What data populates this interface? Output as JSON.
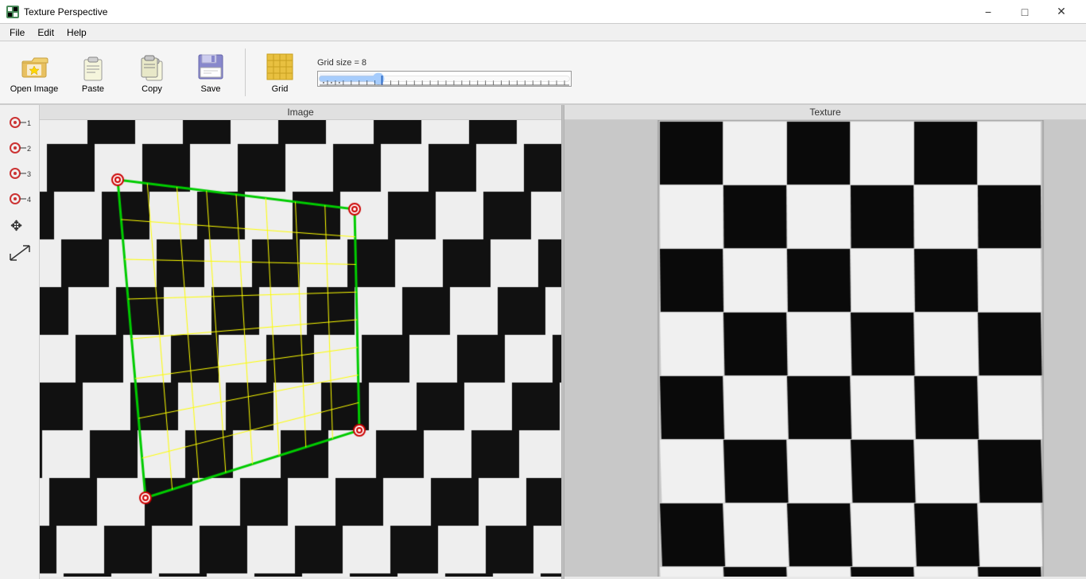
{
  "window": {
    "title": "Texture Perspective",
    "icon": "texture-perspective-icon"
  },
  "titlebar": {
    "minimize_label": "−",
    "maximize_label": "□",
    "close_label": "✕"
  },
  "menu": {
    "items": [
      "File",
      "Edit",
      "Help"
    ]
  },
  "toolbar": {
    "open_image_label": "Open Image",
    "paste_label": "Paste",
    "copy_label": "Copy",
    "save_label": "Save",
    "grid_label": "Grid",
    "grid_size_label": "Grid size = 8",
    "grid_size_value": 8
  },
  "panels": {
    "image_label": "Image",
    "texture_label": "Texture"
  },
  "tools": [
    {
      "id": "tool-1",
      "label": "1"
    },
    {
      "id": "tool-2",
      "label": "2"
    },
    {
      "id": "tool-3",
      "label": "3"
    },
    {
      "id": "tool-4",
      "label": "4"
    },
    {
      "id": "tool-move",
      "label": "move"
    },
    {
      "id": "tool-scale",
      "label": "scale"
    }
  ],
  "colors": {
    "selection_border": "#00cc00",
    "grid_lines": "#ffff00",
    "handle_border": "#cc0000",
    "accent": "#4a7a4a"
  }
}
